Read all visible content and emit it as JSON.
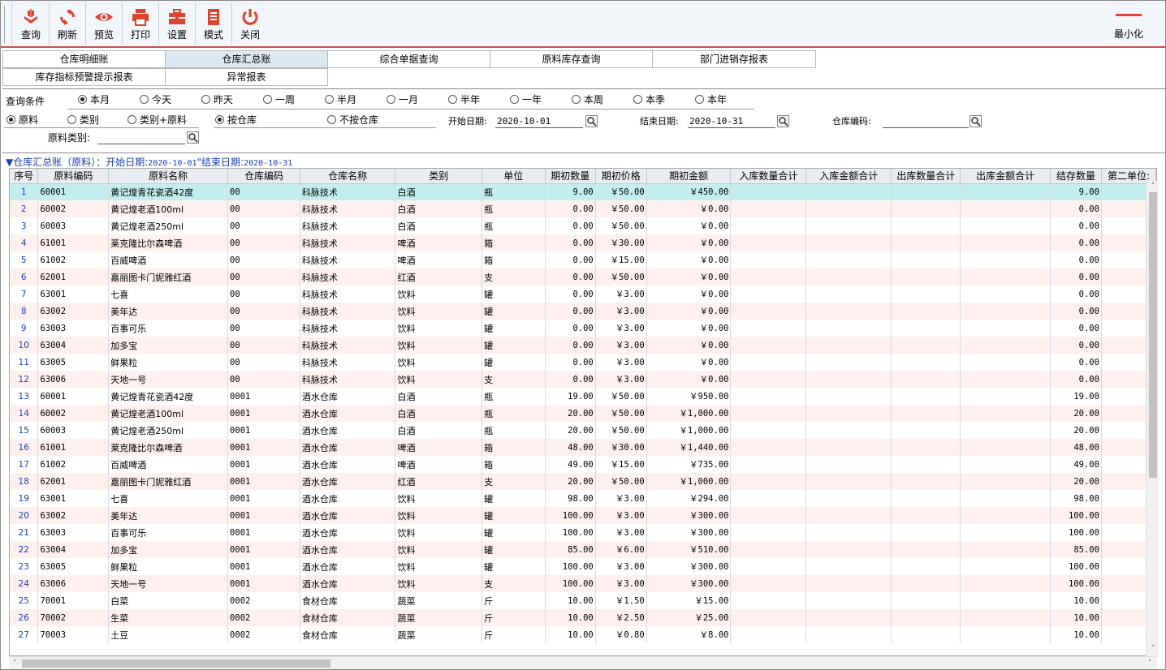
{
  "toolbar": {
    "buttons": [
      {
        "id": "query",
        "label": "查询",
        "icon": "query-icon"
      },
      {
        "id": "refresh",
        "label": "刷新",
        "icon": "refresh-icon"
      },
      {
        "id": "preview",
        "label": "预览",
        "icon": "eye-icon"
      },
      {
        "id": "print",
        "label": "打印",
        "icon": "printer-icon"
      },
      {
        "id": "settings",
        "label": "设置",
        "icon": "toolbox-icon"
      },
      {
        "id": "mode",
        "label": "模式",
        "icon": "document-icon"
      },
      {
        "id": "close",
        "label": "关闭",
        "icon": "power-icon"
      }
    ],
    "minimize_label": "最小化"
  },
  "tabs": [
    {
      "label": "仓库明细账",
      "active": false
    },
    {
      "label": "仓库汇总账",
      "active": true
    },
    {
      "label": "综合单据查询",
      "active": false
    },
    {
      "label": "原料库存查询",
      "active": false
    },
    {
      "label": "部门进销存报表",
      "active": false
    },
    {
      "label": "库存指标预警提示报表",
      "active": false
    },
    {
      "label": "异常报表",
      "active": false
    }
  ],
  "filters": {
    "query_condition_label": "查询条件",
    "periods": [
      {
        "label": "本月",
        "checked": true
      },
      {
        "label": "今天",
        "checked": false
      },
      {
        "label": "昨天",
        "checked": false
      },
      {
        "label": "一周",
        "checked": false
      },
      {
        "label": "半月",
        "checked": false
      },
      {
        "label": "一月",
        "checked": false
      },
      {
        "label": "半年",
        "checked": false
      },
      {
        "label": "一年",
        "checked": false
      },
      {
        "label": "本周",
        "checked": false
      },
      {
        "label": "本季",
        "checked": false
      },
      {
        "label": "本年",
        "checked": false
      }
    ],
    "group_by": [
      {
        "label": "原料",
        "checked": true
      },
      {
        "label": "类别",
        "checked": false
      },
      {
        "label": "类别+原料",
        "checked": false
      }
    ],
    "warehouse_mode": [
      {
        "label": "按仓库",
        "checked": true
      },
      {
        "label": "不按仓库",
        "checked": false
      }
    ],
    "start_date_label": "开始日期:",
    "start_date": "2020-10-01",
    "end_date_label": "结束日期:",
    "end_date": "2020-10-31",
    "warehouse_code_label": "仓库编码:",
    "warehouse_code": "",
    "material_category_label": "原料类别:",
    "material_category": ""
  },
  "grid_title": {
    "name": "▼仓库汇总账（原料）：开始日期:",
    "start": "2020-10-01",
    "sep": "\"结束日期:",
    "end": "2020-10-31"
  },
  "columns": [
    "序号",
    "原料编码",
    "原料名称",
    "仓库编码",
    "仓库名称",
    "类别",
    "单位",
    "期初数量",
    "期初价格",
    "期初金额",
    "入库数量合计",
    "入库金额合计",
    "出库数量合计",
    "出库金额合计",
    "结存数量",
    "第二单位:"
  ],
  "rows": [
    [
      "1",
      "60001",
      "黄记煌青花瓷酒42度",
      "00",
      "科脉技术",
      "白酒",
      "瓶",
      "9.00",
      "￥50.00",
      "￥450.00",
      "",
      "",
      "",
      "",
      "9.00",
      ""
    ],
    [
      "2",
      "60002",
      "黄记煌老酒100ml",
      "00",
      "科脉技术",
      "白酒",
      "瓶",
      "0.00",
      "￥50.00",
      "￥0.00",
      "",
      "",
      "",
      "",
      "0.00",
      ""
    ],
    [
      "3",
      "60003",
      "黄记煌老酒250ml",
      "00",
      "科脉技术",
      "白酒",
      "瓶",
      "0.00",
      "￥50.00",
      "￥0.00",
      "",
      "",
      "",
      "",
      "0.00",
      ""
    ],
    [
      "4",
      "61001",
      "莱克隆比尔森啤酒",
      "00",
      "科脉技术",
      "啤酒",
      "箱",
      "0.00",
      "￥30.00",
      "￥0.00",
      "",
      "",
      "",
      "",
      "0.00",
      ""
    ],
    [
      "5",
      "61002",
      "百威啤酒",
      "00",
      "科脉技术",
      "啤酒",
      "箱",
      "0.00",
      "￥15.00",
      "￥0.00",
      "",
      "",
      "",
      "",
      "0.00",
      ""
    ],
    [
      "6",
      "62001",
      "嘉丽图卡门妮雅红酒",
      "00",
      "科脉技术",
      "红酒",
      "支",
      "0.00",
      "￥50.00",
      "￥0.00",
      "",
      "",
      "",
      "",
      "0.00",
      ""
    ],
    [
      "7",
      "63001",
      "七喜",
      "00",
      "科脉技术",
      "饮料",
      "罐",
      "0.00",
      "￥3.00",
      "￥0.00",
      "",
      "",
      "",
      "",
      "0.00",
      ""
    ],
    [
      "8",
      "63002",
      "美年达",
      "00",
      "科脉技术",
      "饮料",
      "罐",
      "0.00",
      "￥3.00",
      "￥0.00",
      "",
      "",
      "",
      "",
      "0.00",
      ""
    ],
    [
      "9",
      "63003",
      "百事可乐",
      "00",
      "科脉技术",
      "饮料",
      "罐",
      "0.00",
      "￥3.00",
      "￥0.00",
      "",
      "",
      "",
      "",
      "0.00",
      ""
    ],
    [
      "10",
      "63004",
      "加多宝",
      "00",
      "科脉技术",
      "饮料",
      "罐",
      "0.00",
      "￥3.00",
      "￥0.00",
      "",
      "",
      "",
      "",
      "0.00",
      ""
    ],
    [
      "11",
      "63005",
      "鲜果粒",
      "00",
      "科脉技术",
      "饮料",
      "罐",
      "0.00",
      "￥3.00",
      "￥0.00",
      "",
      "",
      "",
      "",
      "0.00",
      ""
    ],
    [
      "12",
      "63006",
      "天地一号",
      "00",
      "科脉技术",
      "饮料",
      "支",
      "0.00",
      "￥3.00",
      "￥0.00",
      "",
      "",
      "",
      "",
      "0.00",
      ""
    ],
    [
      "13",
      "60001",
      "黄记煌青花瓷酒42度",
      "0001",
      "酒水仓库",
      "白酒",
      "瓶",
      "19.00",
      "￥50.00",
      "￥950.00",
      "",
      "",
      "",
      "",
      "19.00",
      ""
    ],
    [
      "14",
      "60002",
      "黄记煌老酒100ml",
      "0001",
      "酒水仓库",
      "白酒",
      "瓶",
      "20.00",
      "￥50.00",
      "￥1,000.00",
      "",
      "",
      "",
      "",
      "20.00",
      ""
    ],
    [
      "15",
      "60003",
      "黄记煌老酒250ml",
      "0001",
      "酒水仓库",
      "白酒",
      "瓶",
      "20.00",
      "￥50.00",
      "￥1,000.00",
      "",
      "",
      "",
      "",
      "20.00",
      ""
    ],
    [
      "16",
      "61001",
      "莱克隆比尔森啤酒",
      "0001",
      "酒水仓库",
      "啤酒",
      "箱",
      "48.00",
      "￥30.00",
      "￥1,440.00",
      "",
      "",
      "",
      "",
      "48.00",
      ""
    ],
    [
      "17",
      "61002",
      "百威啤酒",
      "0001",
      "酒水仓库",
      "啤酒",
      "箱",
      "49.00",
      "￥15.00",
      "￥735.00",
      "",
      "",
      "",
      "",
      "49.00",
      ""
    ],
    [
      "18",
      "62001",
      "嘉丽图卡门妮雅红酒",
      "0001",
      "酒水仓库",
      "红酒",
      "支",
      "20.00",
      "￥50.00",
      "￥1,000.00",
      "",
      "",
      "",
      "",
      "20.00",
      ""
    ],
    [
      "19",
      "63001",
      "七喜",
      "0001",
      "酒水仓库",
      "饮料",
      "罐",
      "98.00",
      "￥3.00",
      "￥294.00",
      "",
      "",
      "",
      "",
      "98.00",
      ""
    ],
    [
      "20",
      "63002",
      "美年达",
      "0001",
      "酒水仓库",
      "饮料",
      "罐",
      "100.00",
      "￥3.00",
      "￥300.00",
      "",
      "",
      "",
      "",
      "100.00",
      ""
    ],
    [
      "21",
      "63003",
      "百事可乐",
      "0001",
      "酒水仓库",
      "饮料",
      "罐",
      "100.00",
      "￥3.00",
      "￥300.00",
      "",
      "",
      "",
      "",
      "100.00",
      ""
    ],
    [
      "22",
      "63004",
      "加多宝",
      "0001",
      "酒水仓库",
      "饮料",
      "罐",
      "85.00",
      "￥6.00",
      "￥510.00",
      "",
      "",
      "",
      "",
      "85.00",
      ""
    ],
    [
      "23",
      "63005",
      "鲜果粒",
      "0001",
      "酒水仓库",
      "饮料",
      "罐",
      "100.00",
      "￥3.00",
      "￥300.00",
      "",
      "",
      "",
      "",
      "100.00",
      ""
    ],
    [
      "24",
      "63006",
      "天地一号",
      "0001",
      "酒水仓库",
      "饮料",
      "支",
      "100.00",
      "￥3.00",
      "￥300.00",
      "",
      "",
      "",
      "",
      "100.00",
      ""
    ],
    [
      "25",
      "70001",
      "白菜",
      "0002",
      "食材仓库",
      "蔬菜",
      "斤",
      "10.00",
      "￥1.50",
      "￥15.00",
      "",
      "",
      "",
      "",
      "10.00",
      ""
    ],
    [
      "26",
      "70002",
      "生菜",
      "0002",
      "食材仓库",
      "蔬菜",
      "斤",
      "10.00",
      "￥2.50",
      "￥25.00",
      "",
      "",
      "",
      "",
      "10.00",
      ""
    ],
    [
      "27",
      "70003",
      "土豆",
      "0002",
      "食材仓库",
      "蔬菜",
      "斤",
      "10.00",
      "￥0.80",
      "￥8.00",
      "",
      "",
      "",
      "",
      "10.00",
      ""
    ]
  ],
  "selected_row": 0
}
